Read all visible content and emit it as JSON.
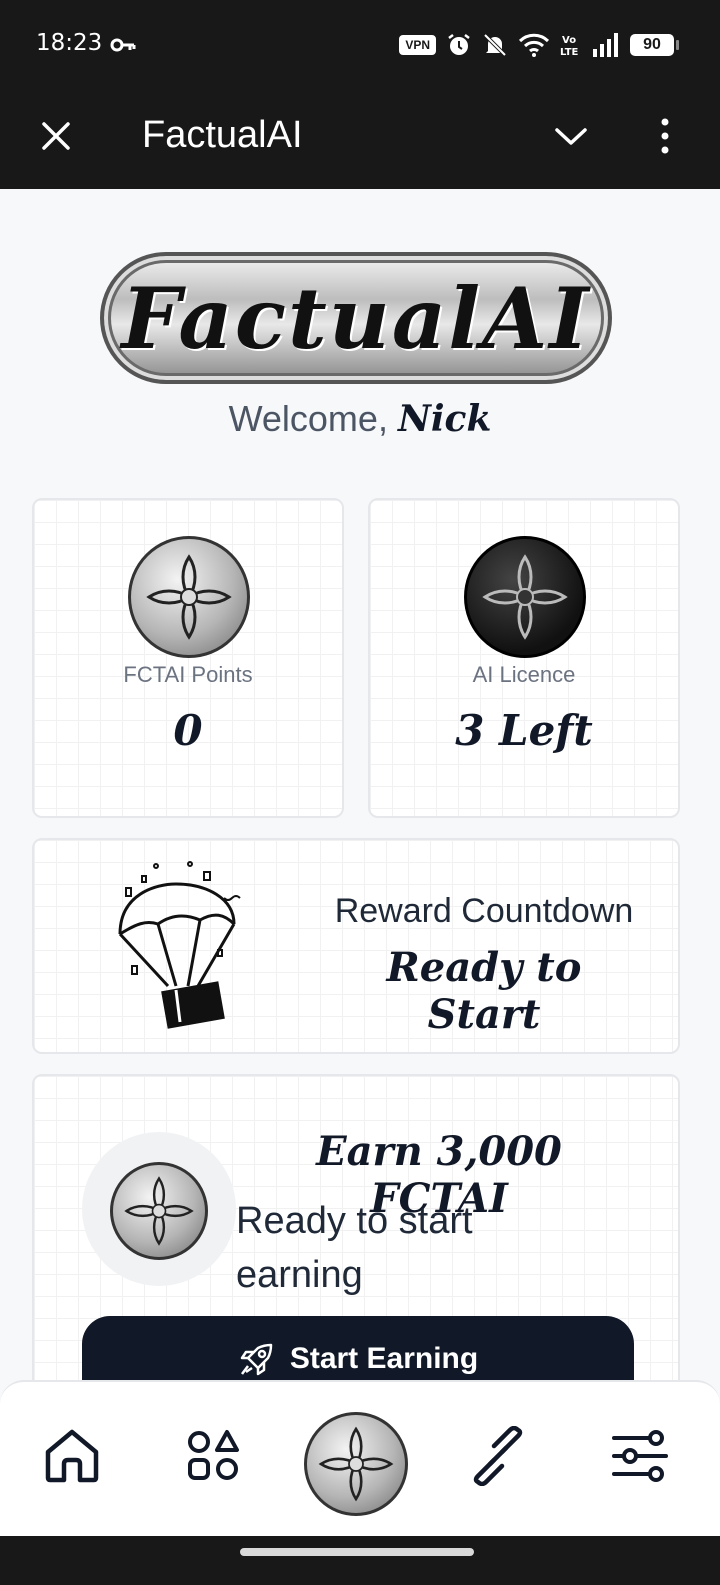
{
  "status_bar": {
    "time": "18:23",
    "vpn": "VPN",
    "battery": "90",
    "icons": [
      "key-icon",
      "vpn-icon",
      "alarm-icon",
      "bell-off-icon",
      "wifi-icon",
      "volte-icon",
      "signal-icon",
      "battery-icon"
    ]
  },
  "app_bar": {
    "title": "FactualAI",
    "close_icon": "close-icon",
    "collapse_icon": "chevron-down-icon",
    "menu_icon": "more-vertical-icon"
  },
  "logo": {
    "text": "FactualAI"
  },
  "welcome": {
    "prefix": "Welcome,",
    "name": "Nick"
  },
  "stats": {
    "points": {
      "label": "FCTAI Points",
      "value": "0"
    },
    "licence": {
      "label": "AI Licence",
      "value": "3 Left"
    }
  },
  "countdown": {
    "label": "Reward Countdown",
    "value": "Ready to Start"
  },
  "earn": {
    "title": "Earn 3,000 FCTAI",
    "subtitle": "Ready to start earning",
    "button_label": "Start Earning",
    "button_icon": "rocket-icon"
  },
  "bottom_nav": {
    "items": [
      "home-icon",
      "apps-icon",
      "coin-icon",
      "link-icon",
      "settings-sliders-icon"
    ]
  },
  "colors": {
    "dark_bar": "#181818",
    "primary_button": "#111827",
    "background": "#f7f8fa"
  }
}
